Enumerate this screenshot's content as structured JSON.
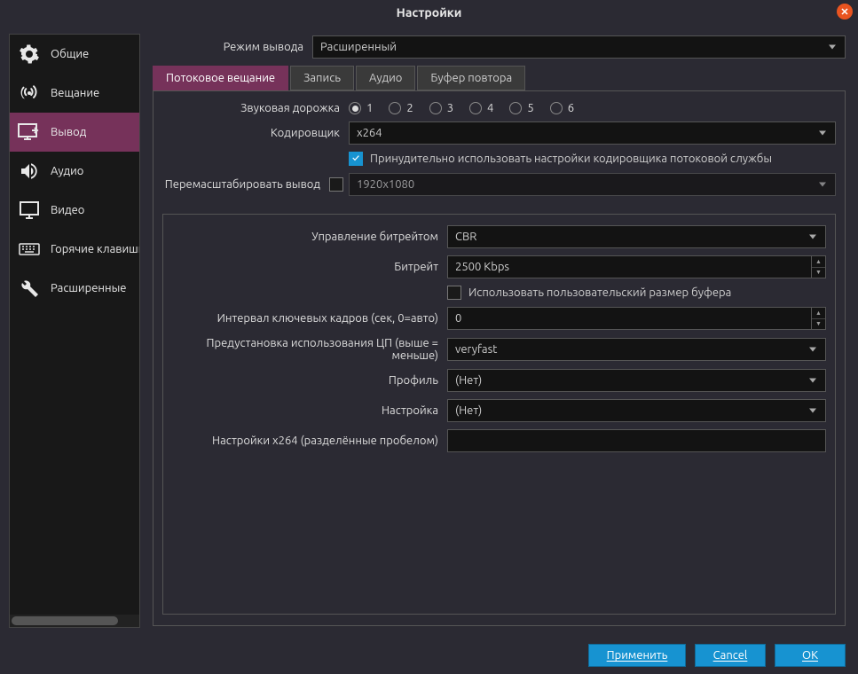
{
  "title": "Настройки",
  "sidebar": {
    "items": [
      {
        "label": "Общие"
      },
      {
        "label": "Вещание"
      },
      {
        "label": "Вывод"
      },
      {
        "label": "Аудио"
      },
      {
        "label": "Видео"
      },
      {
        "label": "Горячие клавиши"
      },
      {
        "label": "Расширенные"
      }
    ]
  },
  "output_mode": {
    "label": "Режим вывода",
    "value": "Расширенный"
  },
  "tabs": [
    {
      "label": "Потоковое вещание"
    },
    {
      "label": "Запись"
    },
    {
      "label": "Аудио"
    },
    {
      "label": "Буфер повтора"
    }
  ],
  "streaming": {
    "audio_track_label": "Звуковая дорожка",
    "audio_tracks": [
      "1",
      "2",
      "3",
      "4",
      "5",
      "6"
    ],
    "audio_track_selected": 0,
    "encoder_label": "Кодировщик",
    "encoder_value": "x264",
    "enforce_checkbox_label": "Принудительно использовать настройки кодировщика потоковой службы",
    "rescale_label": "Перемасштабировать вывод",
    "rescale_value": "1920x1080",
    "rate_control_label": "Управление битрейтом",
    "rate_control_value": "CBR",
    "bitrate_label": "Битрейт",
    "bitrate_value": "2500 Kbps",
    "custom_buffer_label": "Использовать пользовательский размер буфера",
    "keyframe_label": "Интервал ключевых кадров (сек, 0=авто)",
    "keyframe_value": "0",
    "cpu_preset_label": "Предустановка использования ЦП (выше = меньше)",
    "cpu_preset_value": "veryfast",
    "profile_label": "Профиль",
    "profile_value": "(Нет)",
    "tune_label": "Настройка",
    "tune_value": "(Нет)",
    "x264opts_label": "Настройки x264 (разделённые пробелом)",
    "x264opts_value": ""
  },
  "footer": {
    "apply": "Применить",
    "cancel": "Cancel",
    "ok": "OK"
  }
}
